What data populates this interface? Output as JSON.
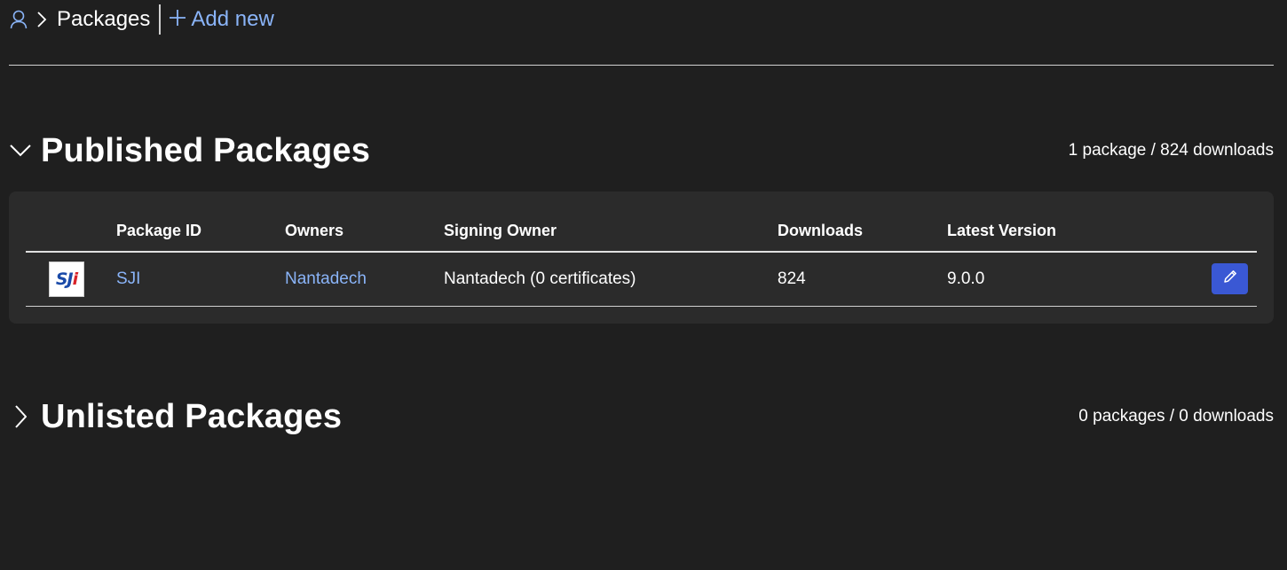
{
  "breadcrumb": {
    "user_icon": "person-icon",
    "separator_icon": "chevron-right-icon",
    "current": "Packages",
    "add_new_icon": "plus-icon",
    "add_new_label": "Add new"
  },
  "published": {
    "expand_icon": "chevron-down-icon",
    "title": "Published Packages",
    "summary": "1 package / 824 downloads",
    "columns": [
      "Package ID",
      "Owners",
      "Signing Owner",
      "Downloads",
      "Latest Version"
    ],
    "rows": [
      {
        "logo_text": [
          "S",
          "J",
          "i"
        ],
        "package_id": "SJI",
        "owners": "Nantadech",
        "signing_owner": "Nantadech (0 certificates)",
        "downloads": "824",
        "latest_version": "9.0.0",
        "edit_icon": "pencil-icon"
      }
    ]
  },
  "unlisted": {
    "expand_icon": "chevron-right-icon",
    "title": "Unlisted Packages",
    "summary": "0 packages / 0 downloads"
  },
  "colors": {
    "background": "#1f1f1f",
    "card": "#2b2b2b",
    "link": "#8ab4f8",
    "edit_button": "#3a58d4"
  }
}
